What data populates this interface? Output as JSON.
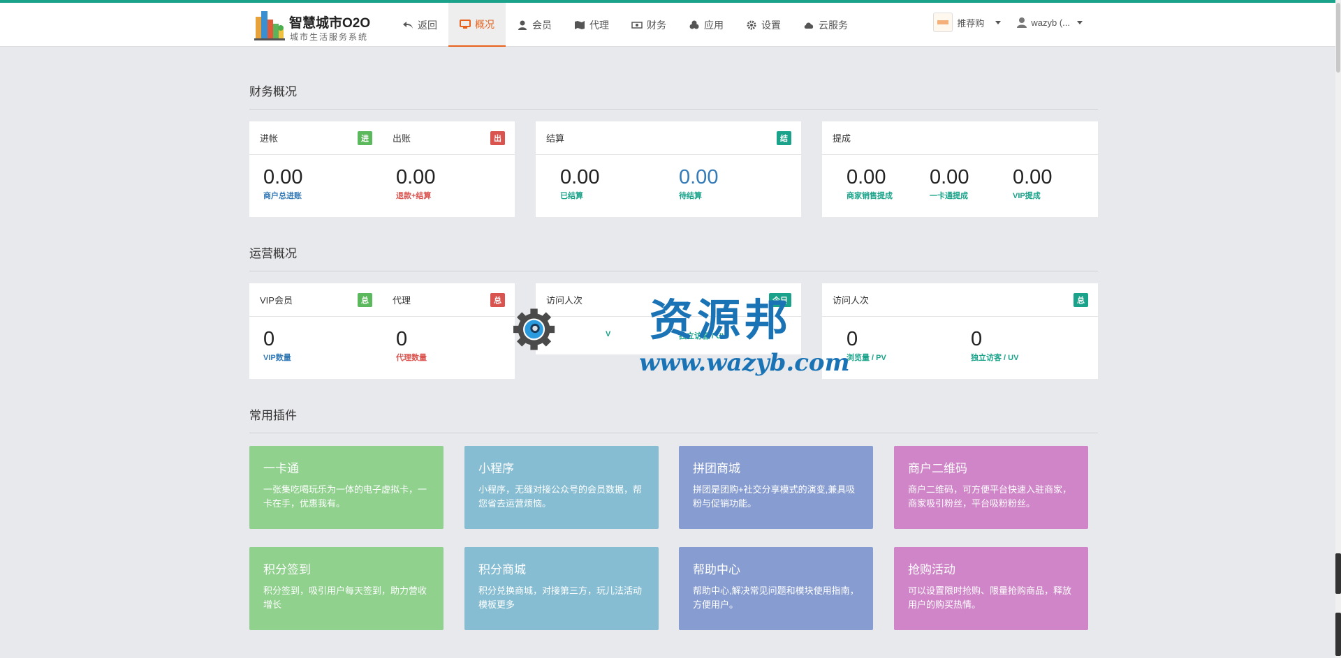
{
  "brand": {
    "title": "智慧城市O2O",
    "subtitle": "城市生活服务系统"
  },
  "nav": [
    {
      "label": "返回",
      "icon": "undo-icon"
    },
    {
      "label": "概况",
      "icon": "monitor-icon",
      "active": true
    },
    {
      "label": "会员",
      "icon": "user-icon"
    },
    {
      "label": "代理",
      "icon": "map-icon"
    },
    {
      "label": "财务",
      "icon": "money-icon"
    },
    {
      "label": "应用",
      "icon": "cubes-icon"
    },
    {
      "label": "设置",
      "icon": "gear-icon"
    },
    {
      "label": "云服务",
      "icon": "cloud-icon"
    }
  ],
  "header_right": {
    "recommend_label": "推荐购",
    "user_label": "wazyb (..."
  },
  "finance": {
    "title": "财务概况",
    "income": {
      "label": "进帐",
      "badge": "进",
      "value": "0.00",
      "caption": "商户总进账"
    },
    "expense": {
      "label": "出账",
      "badge": "出",
      "value": "0.00",
      "caption": "退款+结算"
    },
    "settle": {
      "label": "结算",
      "badge": "结",
      "done_value": "0.00",
      "done_caption": "已结算",
      "pending_value": "0.00",
      "pending_caption": "待结算"
    },
    "commission": {
      "label": "提成",
      "merchant_value": "0.00",
      "merchant_caption": "商家销售提成",
      "card_value": "0.00",
      "card_caption": "一卡通提成",
      "vip_value": "0.00",
      "vip_caption": "VIP提成"
    }
  },
  "operation": {
    "title": "运营概况",
    "vip": {
      "label": "VIP会员",
      "badge": "总",
      "value": "0",
      "caption": "VIP数量"
    },
    "agent": {
      "label": "代理",
      "badge": "总",
      "value": "0",
      "caption": "代理数量"
    },
    "visits_mid": {
      "label": "访问人次",
      "badge": "今日",
      "caption_right": "独立访客 / UV",
      "caption_left": "V"
    },
    "visits": {
      "label": "访问人次",
      "badge": "总",
      "pv_value": "0",
      "pv_caption": "浏览量 / PV",
      "uv_value": "0",
      "uv_caption": "独立访客 / UV"
    }
  },
  "plugins": {
    "title": "常用插件",
    "items": [
      {
        "title": "一卡通",
        "desc": "一张集吃喝玩乐为一体的电子虚拟卡，一卡在手，优惠我有。",
        "color": "#8fd18d"
      },
      {
        "title": "小程序",
        "desc": "小程序，无缝对接公众号的会员数据，帮您省去运营烦恼。",
        "color": "#86bdd2"
      },
      {
        "title": "拼团商城",
        "desc": "拼团是团购+社交分享模式的演变,兼具吸粉与促销功能。",
        "color": "#879cd0"
      },
      {
        "title": "商户二维码",
        "desc": "商户二维码，可方便平台快速入驻商家，商家吸引粉丝，平台吸粉粉丝。",
        "color": "#cf85c8"
      },
      {
        "title": "积分签到",
        "desc": "积分签到，吸引用户每天签到，助力营收增长",
        "color": "#8fd18d"
      },
      {
        "title": "积分商城",
        "desc": "积分兑换商城，对接第三方，玩儿法活动模板更多",
        "color": "#86bdd2"
      },
      {
        "title": "帮助中心",
        "desc": "帮助中心,解决常见问题和模块使用指南，方便用户。",
        "color": "#879cd0"
      },
      {
        "title": "抢购活动",
        "desc": "可以设置限时抢购、限量抢购商品，释放用户的购买热情。",
        "color": "#cf85c8"
      }
    ]
  },
  "watermark": {
    "text": "资源邦",
    "url": "www.wazyb.com"
  },
  "colors": {
    "accent": "#e8621e",
    "green_badge": "#5cb85c",
    "red_badge": "#d9534f",
    "teal_badge": "#1aa38a",
    "blue_caption": "#337ab7",
    "red_caption": "#d9534f",
    "teal_caption": "#1aa38a"
  }
}
